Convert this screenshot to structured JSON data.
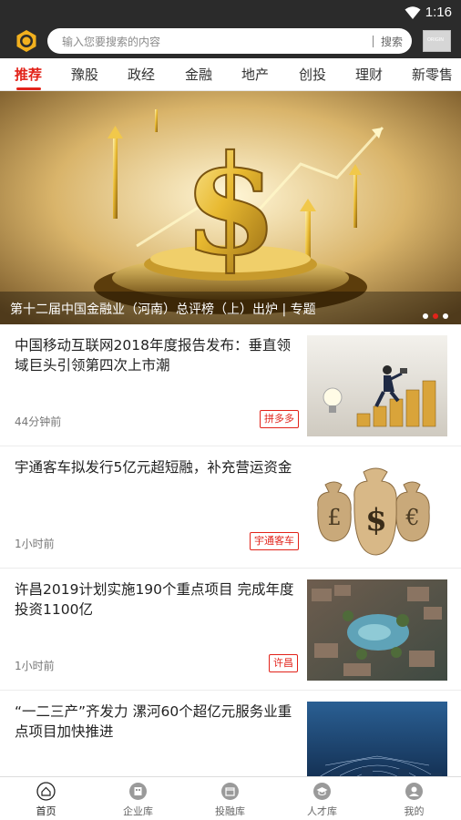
{
  "status_bar": {
    "time": "1:16",
    "wifi_icon": "wifi-icon"
  },
  "search": {
    "placeholder": "输入您要搜索的内容",
    "button_label": "搜索",
    "logo_icon": "app-logo-icon"
  },
  "tabs": [
    {
      "label": "推荐",
      "active": true
    },
    {
      "label": "豫股"
    },
    {
      "label": "政经"
    },
    {
      "label": "金融"
    },
    {
      "label": "地产"
    },
    {
      "label": "创投"
    },
    {
      "label": "理财"
    },
    {
      "label": "新零售"
    }
  ],
  "banner": {
    "caption": "第十二届中国金融业（河南）总评榜（上）出炉 | 专题",
    "slide_count": 3,
    "active_slide": 2
  },
  "news": [
    {
      "title": "中国移动互联网2018年度报告发布：垂直领域巨头引领第四次上市潮",
      "time": "44分钟前",
      "tag": "拼多多"
    },
    {
      "title": "宇通客车拟发行5亿元超短融，补充营运资金",
      "time": "1小时前",
      "tag": "宇通客车"
    },
    {
      "title": "许昌2019计划实施190个重点项目 完成年度投资1100亿",
      "time": "1小时前",
      "tag": "许昌"
    },
    {
      "title": "“一二三产”齐发力 漯河60个超亿元服务业重点项目加快推进",
      "time": "",
      "tag": ""
    }
  ],
  "bottom_nav": [
    {
      "label": "首页",
      "icon": "home-icon",
      "active": true
    },
    {
      "label": "企业库",
      "icon": "company-icon"
    },
    {
      "label": "投融库",
      "icon": "finance-icon"
    },
    {
      "label": "人才库",
      "icon": "talent-icon"
    },
    {
      "label": "我的",
      "icon": "profile-icon"
    }
  ],
  "colors": {
    "accent": "#e2231a",
    "header_bg": "#2b2b2b"
  }
}
